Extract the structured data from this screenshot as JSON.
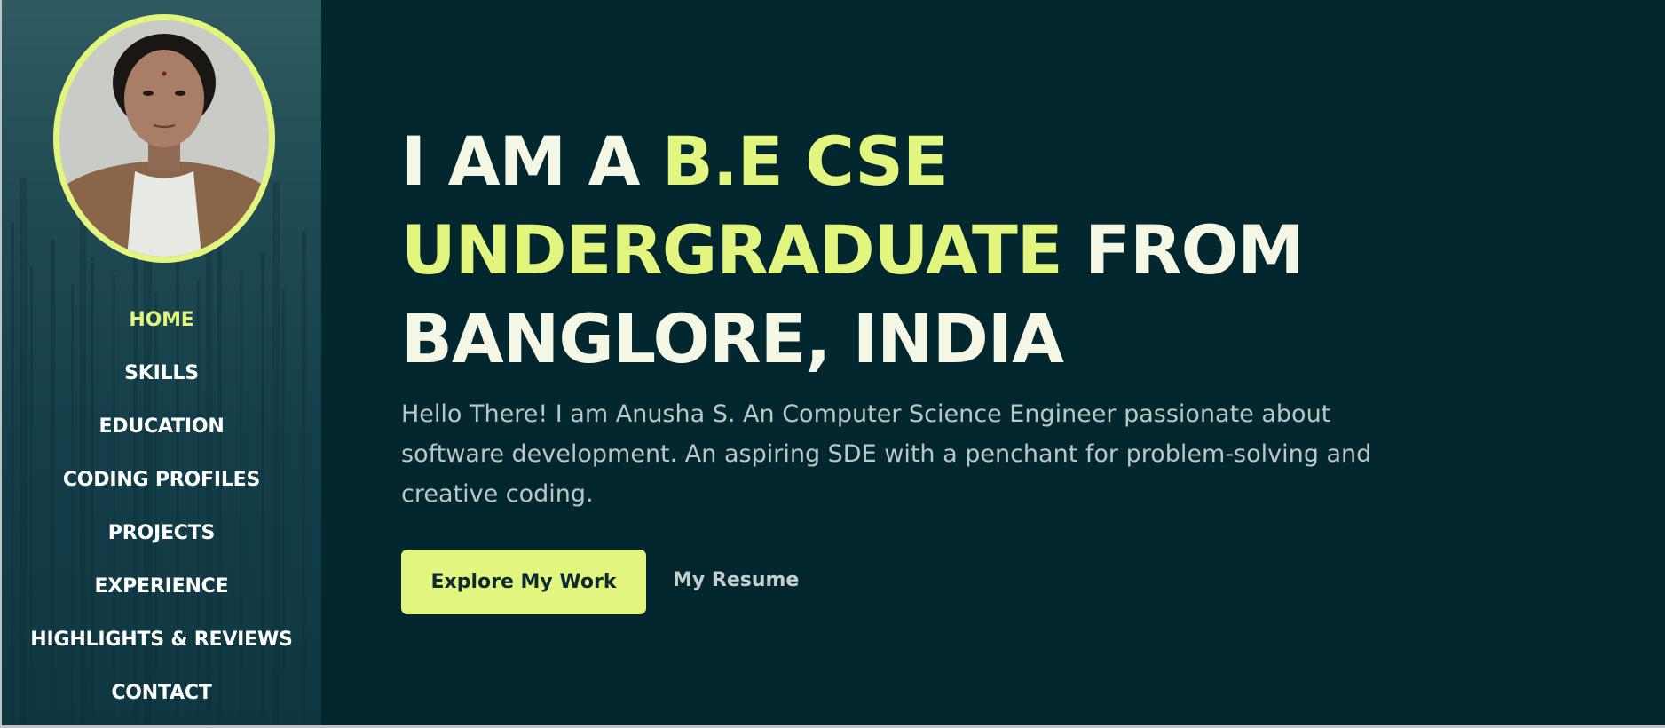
{
  "sidebar": {
    "avatar_alt": "profile-photo",
    "items": [
      {
        "label": "HOME"
      },
      {
        "label": "SKILLS"
      },
      {
        "label": "EDUCATION"
      },
      {
        "label": "CODING PROFILES"
      },
      {
        "label": "PROJECTS"
      },
      {
        "label": "EXPERIENCE"
      },
      {
        "label": "HIGHLIGHTS & REVIEWS"
      },
      {
        "label": "CONTACT"
      }
    ]
  },
  "hero": {
    "headline_part1": "I AM A ",
    "headline_highlight": "B.E CSE UNDERGRADUATE",
    "headline_part2": " FROM BANGLORE, INDIA",
    "intro": "Hello There! I am Anusha S. An Computer Science Engineer passionate about software development. An aspiring SDE with a penchant for problem-solving and creative coding.",
    "primary_button": "Explore My Work",
    "secondary_button": "My Resume"
  },
  "colors": {
    "accent": "#e1f57f",
    "background": "#03272f",
    "sidebar": "#1f4a53",
    "text_light": "#f3f7e4"
  }
}
